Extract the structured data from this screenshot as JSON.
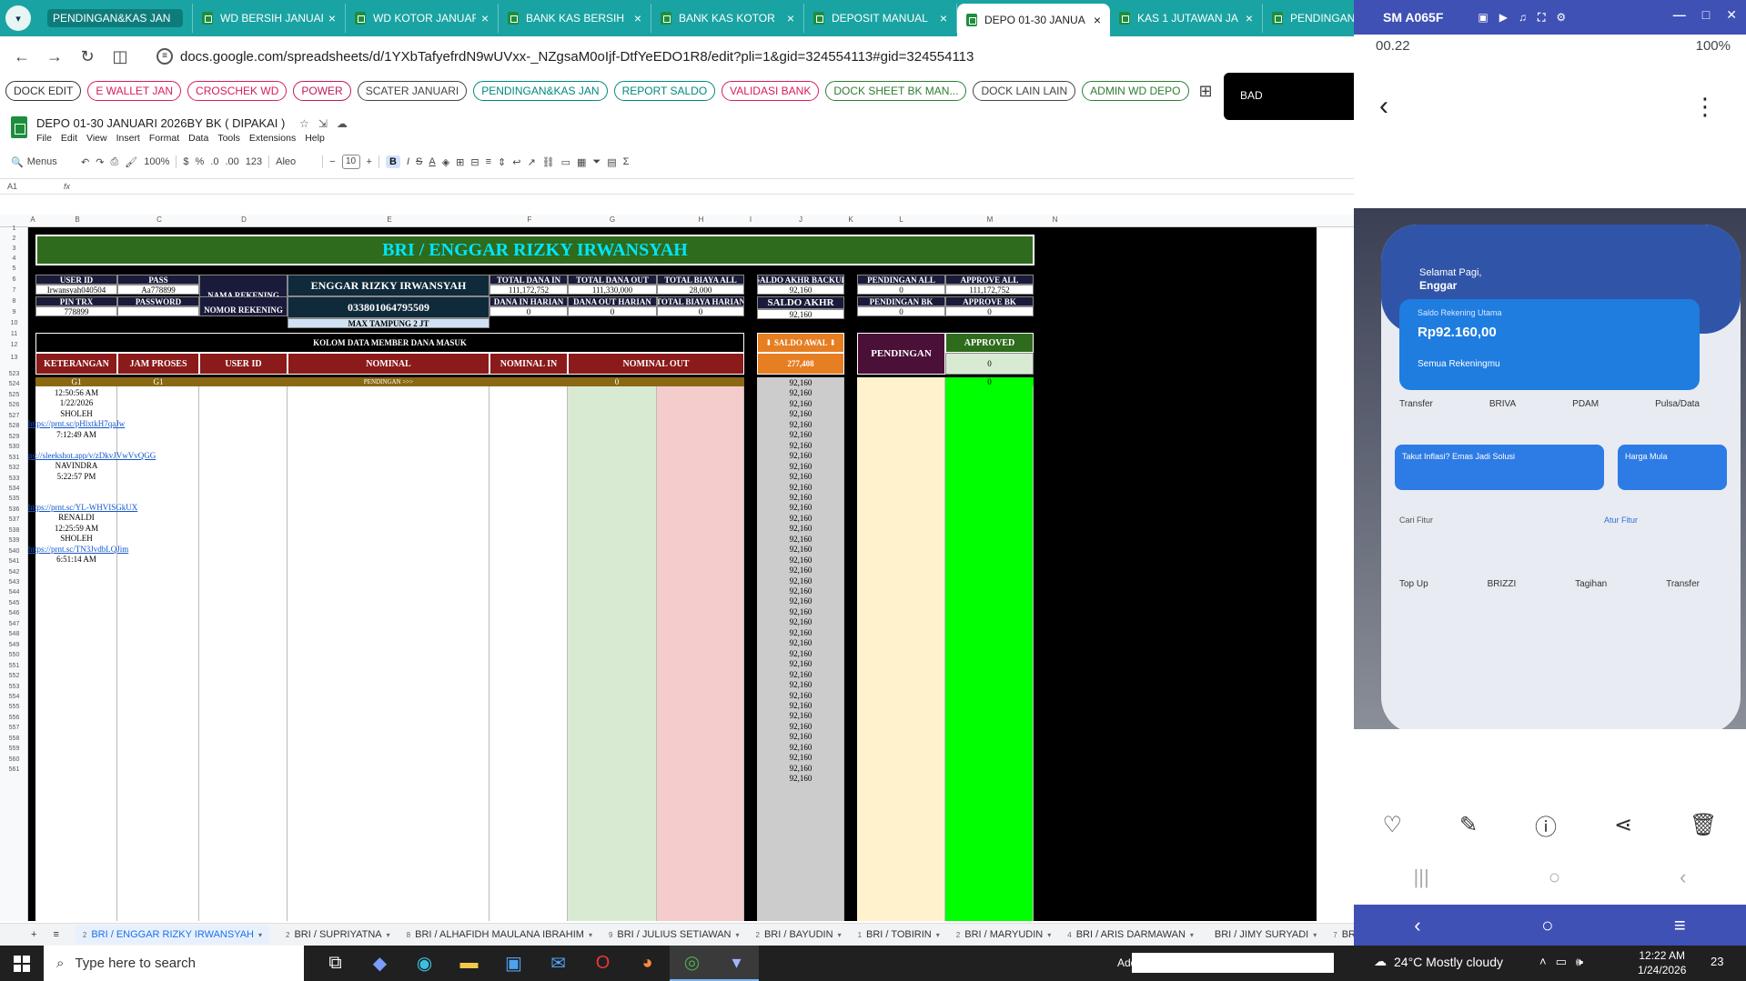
{
  "browser": {
    "tabs": [
      {
        "title": "PENDINGAN&KAS JAN",
        "active": false
      },
      {
        "title": "WD BERSIH JANUAR",
        "active": false
      },
      {
        "title": "WD KOTOR JANUAR",
        "active": false
      },
      {
        "title": "BANK KAS BERSIH",
        "active": false
      },
      {
        "title": "BANK KAS KOTOR",
        "active": false
      },
      {
        "title": "DEPOSIT MANUAL",
        "active": false
      },
      {
        "title": "DEPO 01-30 JANUA",
        "active": true
      },
      {
        "title": "KAS 1 JUTAWAN JA",
        "active": false
      },
      {
        "title": "PENDINGAN EW",
        "active": false
      }
    ],
    "url": "docs.google.com/spreadsheets/d/1YXbTafyefrdN9wUVxx-_NZgsaM0oIjf-DtfYeEDO1R8/edit?pli=1&gid=324554113#gid=324554113",
    "bookmarks": [
      {
        "label": "DOCK EDIT",
        "color": "#333333"
      },
      {
        "label": "E WALLET JAN",
        "color": "#d81b60"
      },
      {
        "label": "CROSCHEK WD",
        "color": "#d81b60"
      },
      {
        "label": "POWER",
        "color": "#c2185b"
      },
      {
        "label": "SCATER JANUARI",
        "color": "#444444"
      },
      {
        "label": "PENDINGAN&KAS JAN",
        "color": "#00897b"
      },
      {
        "label": "REPORT SALDO",
        "color": "#00897b"
      },
      {
        "label": "VALIDASI BANK",
        "color": "#d81b60"
      },
      {
        "label": "DOCK SHEET BK MAN...",
        "color": "#2e7d32"
      },
      {
        "label": "DOCK LAIN LAIN",
        "color": "#444444"
      },
      {
        "label": "ADMIN WD DEPO",
        "color": "#2e7d32"
      }
    ],
    "popup_text": "BAD"
  },
  "sheet": {
    "doc_title": "DEPO 01-30 JANUARI  2026BY BK ( DIPAKAI )",
    "menu": [
      "File",
      "Edit",
      "View",
      "Insert",
      "Format",
      "Data",
      "Tools",
      "Extensions",
      "Help"
    ],
    "toolbar": {
      "search": "Menus",
      "zoom": "100%",
      "currency": "$",
      "percent": "%",
      "dec_minus": ".0",
      "dec_plus": ".00",
      "numfmt": "123",
      "font": "Aleo",
      "font_size": "10",
      "bold": "B",
      "italic": "I"
    },
    "cell_ref": "A1",
    "fx": "fx",
    "columns": [
      "A",
      "B",
      "C",
      "D",
      "E",
      "F",
      "G",
      "H",
      "I",
      "J",
      "K",
      "L",
      "M",
      "N"
    ],
    "title_banner": "BRI / ENGGAR RIZKY IRWANSYAH",
    "info": {
      "user_id_label": "USER ID",
      "pass_label": "PASS",
      "user_id": "Irwansyah040504",
      "pass": "Aa778899",
      "pin_label": "PIN TRX",
      "password_label": "PASSWORD",
      "pin": "778899",
      "nama_rekening_label": "NAMA REKENING",
      "nomor_rekening_label": "NOMOR REKENING",
      "nama_rekening": "ENGGAR RIZKY IRWANSYAH",
      "nomor_rekening": "033801064795509",
      "max_tampung": "MAX TAMPUNG 2 JT",
      "total_dana_in_label": "TOTAL DANA IN",
      "total_dana_out_label": "TOTAL DANA OUT",
      "total_biaya_all_label": "TOTAL BIAYA ALL",
      "total_dana_in": "111,172,752",
      "total_dana_out": "111,330,000",
      "total_biaya_all": "28,000",
      "dana_in_harian_label": "DANA IN HARIAN",
      "dana_out_harian_label": "DANA OUT HARIAN",
      "total_biaya_harian_label": "TOTAL BIAYA HARIAN",
      "dana_in_harian": "0",
      "dana_out_harian": "0",
      "total_biaya_harian": "0",
      "saldo_akhr_backup_label": "SALDO AKHR BACKUP",
      "saldo_akhr_backup": "92,160",
      "saldo_akhr_label": "SALDO AKHR",
      "saldo_akhr": "92,160",
      "pendingan_all_label": "PENDINGAN ALL",
      "approve_all_label": "APPROVE ALL",
      "pendingan_all": "0",
      "approve_all": "111,172,752",
      "pendingan_bk_label": "PENDINGAN BK",
      "approve_bk_label": "APPROVE BK",
      "pendingan_bk": "0",
      "approve_bk": "0"
    },
    "kolom_title": "KOLOM DATA MEMBER DANA MASUK",
    "table_headers": [
      "KETERANGAN",
      "JAM PROSES",
      "USER ID",
      "NOMINAL",
      "NOMINAL IN",
      "NOMINAL OUT"
    ],
    "saldo_awal_label": "⬇ SALDO AWAL ⬇",
    "saldo_awal": "277,408",
    "pendingan_label": "PENDINGAN",
    "approved_label": "APPROVED",
    "approved_value": "0",
    "g1_row": {
      "a": "G1",
      "b": "G1",
      "pendingan": "PENDINGAN >>>",
      "zero": "0",
      "approved_zero": "0"
    },
    "saldo_running": "92,160",
    "row_numbers_top": [
      "1",
      "2",
      "3",
      "4",
      "5",
      "6",
      "7",
      "8",
      "9",
      "10",
      "11",
      "12",
      "13"
    ],
    "rows": [
      {
        "n": "523",
        "b": "G1",
        "link": false
      },
      {
        "n": "524",
        "b": "12:50:56 AM",
        "link": false
      },
      {
        "n": "525",
        "b": "1/22/2026",
        "link": false
      },
      {
        "n": "526",
        "b": "SHOLEH",
        "link": false
      },
      {
        "n": "527",
        "b": "https://prnt.sc/pHlxtkH7qaJw",
        "link": true
      },
      {
        "n": "528",
        "b": "7:12:49 AM",
        "link": false
      },
      {
        "n": "529",
        "b": "",
        "link": false
      },
      {
        "n": "530",
        "b": "ps://sleekshot.app/v/zDkvJVwVvQGG",
        "link": true
      },
      {
        "n": "531",
        "b": "NAVINDRA",
        "link": false
      },
      {
        "n": "532",
        "b": "5:22:57 PM",
        "link": false
      },
      {
        "n": "533",
        "b": "",
        "link": false
      },
      {
        "n": "534",
        "b": "",
        "link": false
      },
      {
        "n": "535",
        "b": "https://prnt.sc/YL-WHVISGkUX",
        "link": true
      },
      {
        "n": "536",
        "b": "RENALDI",
        "link": false
      },
      {
        "n": "537",
        "b": "12:25:59 AM",
        "link": false
      },
      {
        "n": "538",
        "b": "SHOLEH",
        "link": false
      },
      {
        "n": "539",
        "b": "https://prnt.sc/TN3JvdbLQJim",
        "link": true
      },
      {
        "n": "540",
        "b": "6:51:14 AM",
        "link": false
      },
      {
        "n": "541",
        "b": "",
        "link": false
      },
      {
        "n": "542",
        "b": "",
        "link": false
      },
      {
        "n": "543",
        "b": "",
        "link": false
      },
      {
        "n": "544",
        "b": "",
        "link": false
      },
      {
        "n": "545",
        "b": "",
        "link": false
      },
      {
        "n": "546",
        "b": "",
        "link": false
      },
      {
        "n": "547",
        "b": "",
        "link": false
      },
      {
        "n": "548",
        "b": "",
        "link": false
      },
      {
        "n": "549",
        "b": "",
        "link": false
      },
      {
        "n": "550",
        "b": "",
        "link": false
      },
      {
        "n": "551",
        "b": "",
        "link": false
      },
      {
        "n": "552",
        "b": "",
        "link": false
      },
      {
        "n": "553",
        "b": "",
        "link": false
      },
      {
        "n": "554",
        "b": "",
        "link": false
      },
      {
        "n": "555",
        "b": "",
        "link": false
      },
      {
        "n": "556",
        "b": "",
        "link": false
      },
      {
        "n": "557",
        "b": "",
        "link": false
      },
      {
        "n": "558",
        "b": "",
        "link": false
      },
      {
        "n": "559",
        "b": "",
        "link": false
      },
      {
        "n": "560",
        "b": "",
        "link": false
      },
      {
        "n": "561",
        "b": "",
        "link": false
      }
    ],
    "sheet_tabs": [
      {
        "num": "2",
        "label": "BRI / ENGGAR RIZKY IRWANSYAH",
        "active": true
      },
      {
        "num": "2",
        "label": "BRI / SUPRIYATNA",
        "active": false
      },
      {
        "num": "8",
        "label": "BRI / ALHAFIDH MAULANA IBRAHIM",
        "active": false
      },
      {
        "num": "9",
        "label": "BRI / JULIUS SETIAWAN",
        "active": false
      },
      {
        "num": "2",
        "label": "BRI / BAYUDIN",
        "active": false
      },
      {
        "num": "1",
        "label": "BRI / TOBIRIN",
        "active": false
      },
      {
        "num": "2",
        "label": "BRI / MARYUDIN",
        "active": false
      },
      {
        "num": "4",
        "label": "BRI / ARIS DARMAWAN",
        "active": false
      },
      {
        "num": "",
        "label": "BRI / JIMY SURYADI",
        "active": false
      },
      {
        "num": "7",
        "label": "BRI / ",
        "active": false
      }
    ]
  },
  "phone": {
    "window_title": "SM A065F",
    "status_time": "00.22",
    "battery": "100%",
    "app_greeting": "Selamat Pagi,",
    "app_name": "Enggar",
    "balance_label": "Saldo Rekening Utama",
    "balance": "Rp92.160,00",
    "all_accounts": "Semua Rekeningmu",
    "quick_menu": [
      "Transfer",
      "BRIVA",
      "PDAM",
      "Pulsa/Data"
    ],
    "promo": "Takut Inflasi? Emas Jadi Solusi",
    "promo2": "Harga Mula",
    "search_feature": "Cari Fitur",
    "set_feature": "Atur Fitur",
    "menu2": [
      "Top Up",
      "BRIZZI",
      "Tagihan",
      "Transfer"
    ]
  },
  "taskbar": {
    "search_placeholder": "Type here to search",
    "address_label": "Address",
    "weather": "24°C  Mostly cloudy",
    "time": "12:22 AM",
    "date": "1/24/2026",
    "notif_count": "23"
  }
}
